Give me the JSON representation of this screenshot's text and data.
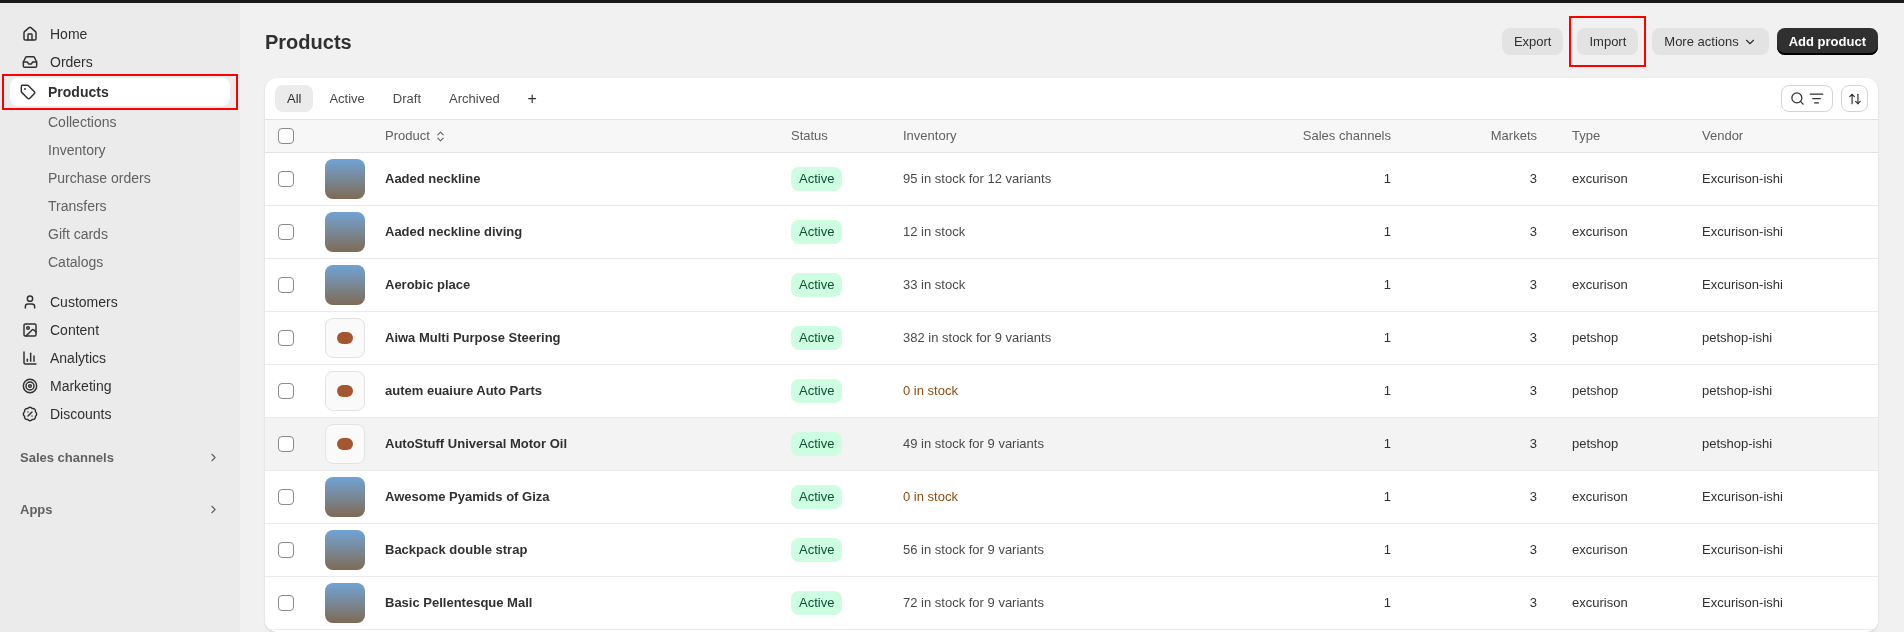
{
  "sidebar": {
    "items": [
      {
        "label": "Home",
        "selected": false,
        "highlighted": false
      },
      {
        "label": "Orders",
        "selected": false,
        "highlighted": false
      },
      {
        "label": "Products",
        "selected": true,
        "highlighted": true,
        "children": [
          {
            "label": "Collections"
          },
          {
            "label": "Inventory"
          },
          {
            "label": "Purchase orders"
          },
          {
            "label": "Transfers"
          },
          {
            "label": "Gift cards"
          },
          {
            "label": "Catalogs"
          }
        ]
      },
      {
        "label": "Customers",
        "selected": false,
        "highlighted": false
      },
      {
        "label": "Content",
        "selected": false,
        "highlighted": false
      },
      {
        "label": "Analytics",
        "selected": false,
        "highlighted": false
      },
      {
        "label": "Marketing",
        "selected": false,
        "highlighted": false
      },
      {
        "label": "Discounts",
        "selected": false,
        "highlighted": false
      }
    ],
    "sections": [
      {
        "label": "Sales channels"
      },
      {
        "label": "Apps"
      }
    ]
  },
  "page": {
    "title": "Products",
    "actions": [
      {
        "label": "Export",
        "kind": "secondary",
        "highlighted": false
      },
      {
        "label": "Import",
        "kind": "secondary",
        "highlighted": true
      },
      {
        "label": "More actions",
        "kind": "menu",
        "highlighted": false
      },
      {
        "label": "Add product",
        "kind": "primary",
        "highlighted": false
      }
    ]
  },
  "tabs": [
    {
      "label": "All",
      "selected": true
    },
    {
      "label": "Active",
      "selected": false
    },
    {
      "label": "Draft",
      "selected": false
    },
    {
      "label": "Archived",
      "selected": false
    }
  ],
  "add_tab": "+",
  "table": {
    "columns": [
      "Product",
      "Status",
      "Inventory",
      "Sales channels",
      "Markets",
      "Type",
      "Vendor"
    ],
    "all_checked": false,
    "rows": [
      {
        "kind": "photo",
        "checked": false,
        "product": "Aaded neckline",
        "status": "Active",
        "inventory": "95 in stock for 12 variants",
        "out_of_stock": false,
        "sales_channels": "1",
        "markets": "3",
        "type": "excurison",
        "vendor": "Excurison-ishi",
        "hovered": false
      },
      {
        "kind": "photo",
        "checked": false,
        "product": "Aaded neckline diving",
        "status": "Active",
        "inventory": "12 in stock",
        "out_of_stock": false,
        "sales_channels": "1",
        "markets": "3",
        "type": "excurison",
        "vendor": "Excurison-ishi",
        "hovered": false
      },
      {
        "kind": "photo",
        "checked": false,
        "product": "Aerobic place",
        "status": "Active",
        "inventory": "33 in stock",
        "out_of_stock": false,
        "sales_channels": "1",
        "markets": "3",
        "type": "excurison",
        "vendor": "Excurison-ishi",
        "hovered": false
      },
      {
        "kind": "item",
        "checked": false,
        "product": "Aiwa Multi Purpose Steering",
        "status": "Active",
        "inventory": "382 in stock for 9 variants",
        "out_of_stock": false,
        "sales_channels": "1",
        "markets": "3",
        "type": "petshop",
        "vendor": "petshop-ishi",
        "hovered": false
      },
      {
        "kind": "item",
        "checked": false,
        "product": "autem euaiure Auto Parts",
        "status": "Active",
        "inventory": "0 in stock",
        "out_of_stock": true,
        "sales_channels": "1",
        "markets": "3",
        "type": "petshop",
        "vendor": "petshop-ishi",
        "hovered": false
      },
      {
        "kind": "item",
        "checked": false,
        "product": "AutoStuff Universal Motor Oil",
        "status": "Active",
        "inventory": "49 in stock for 9 variants",
        "out_of_stock": false,
        "sales_channels": "1",
        "markets": "3",
        "type": "petshop",
        "vendor": "petshop-ishi",
        "hovered": true
      },
      {
        "kind": "photo",
        "checked": false,
        "product": "Awesome Pyamids of Giza",
        "status": "Active",
        "inventory": "0 in stock",
        "out_of_stock": true,
        "sales_channels": "1",
        "markets": "3",
        "type": "excurison",
        "vendor": "Excurison-ishi",
        "hovered": false
      },
      {
        "kind": "photo",
        "checked": false,
        "product": "Backpack double strap",
        "status": "Active",
        "inventory": "56 in stock for 9 variants",
        "out_of_stock": false,
        "sales_channels": "1",
        "markets": "3",
        "type": "excurison",
        "vendor": "Excurison-ishi",
        "hovered": false
      },
      {
        "kind": "photo",
        "checked": false,
        "product": "Basic Pellentesque Mall",
        "status": "Active",
        "inventory": "72 in stock for 9 variants",
        "out_of_stock": false,
        "sales_channels": "1",
        "markets": "3",
        "type": "excurison",
        "vendor": "Excurison-ishi",
        "hovered": false
      }
    ]
  }
}
